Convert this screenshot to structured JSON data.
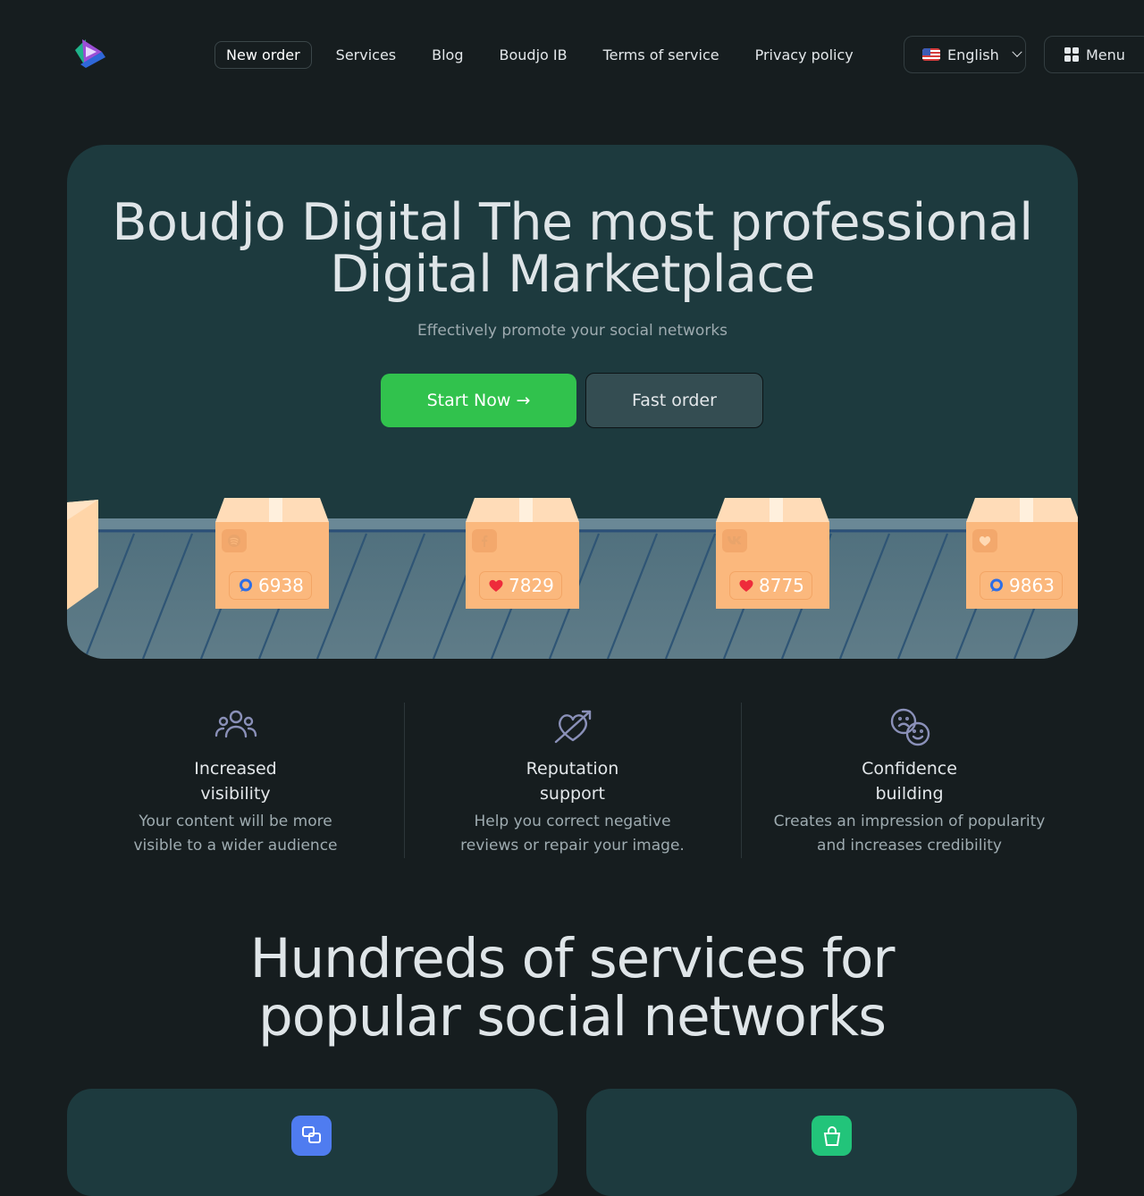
{
  "nav": {
    "items": [
      "New order",
      "Services",
      "Blog",
      "Boudjo IB",
      "Terms of service",
      "Privacy policy"
    ],
    "language": "English",
    "menu_label": "Menu"
  },
  "hero": {
    "title_line1": "Boudjo Digital The most professional",
    "title_line2": "Digital Marketplace",
    "subtitle": "Effectively promote your social networks",
    "start_label": "Start Now →",
    "fast_label": "Fast order",
    "boxes": [
      {
        "platform_icon": "spotify-icon",
        "badge_icon": "comment-icon",
        "count": "6938"
      },
      {
        "platform_icon": "facebook-icon",
        "badge_icon": "heart-icon",
        "count": "7829"
      },
      {
        "platform_icon": "vk-icon",
        "badge_icon": "heart-icon",
        "count": "8775"
      },
      {
        "platform_icon": "like-heart-icon",
        "badge_icon": "comment-icon",
        "count": "9863"
      }
    ]
  },
  "features": [
    {
      "icon": "users-icon",
      "title_line1": "Increased",
      "title_line2": "visibility",
      "desc_line1": "Your content will be more",
      "desc_line2": "visible to a wider audience"
    },
    {
      "icon": "heart-arrow-icon",
      "title_line1": "Reputation",
      "title_line2": "support",
      "desc_line1": "Help you correct negative",
      "desc_line2": "reviews or repair your image."
    },
    {
      "icon": "emoji-faces-icon",
      "title_line1": "Confidence",
      "title_line2": "building",
      "desc_line1": "Creates an impression of popularity",
      "desc_line2": "and increases credibility"
    }
  ],
  "services_section": {
    "title_line1": "Hundreds of services for",
    "title_line2": "popular social networks"
  },
  "colors": {
    "background": "#161d1f",
    "card": "#1d3a3e",
    "accent_green": "#31c24d",
    "box": "#fbb87d",
    "card_icon_blue": "#4f7cf0",
    "card_icon_green": "#22c47a"
  }
}
